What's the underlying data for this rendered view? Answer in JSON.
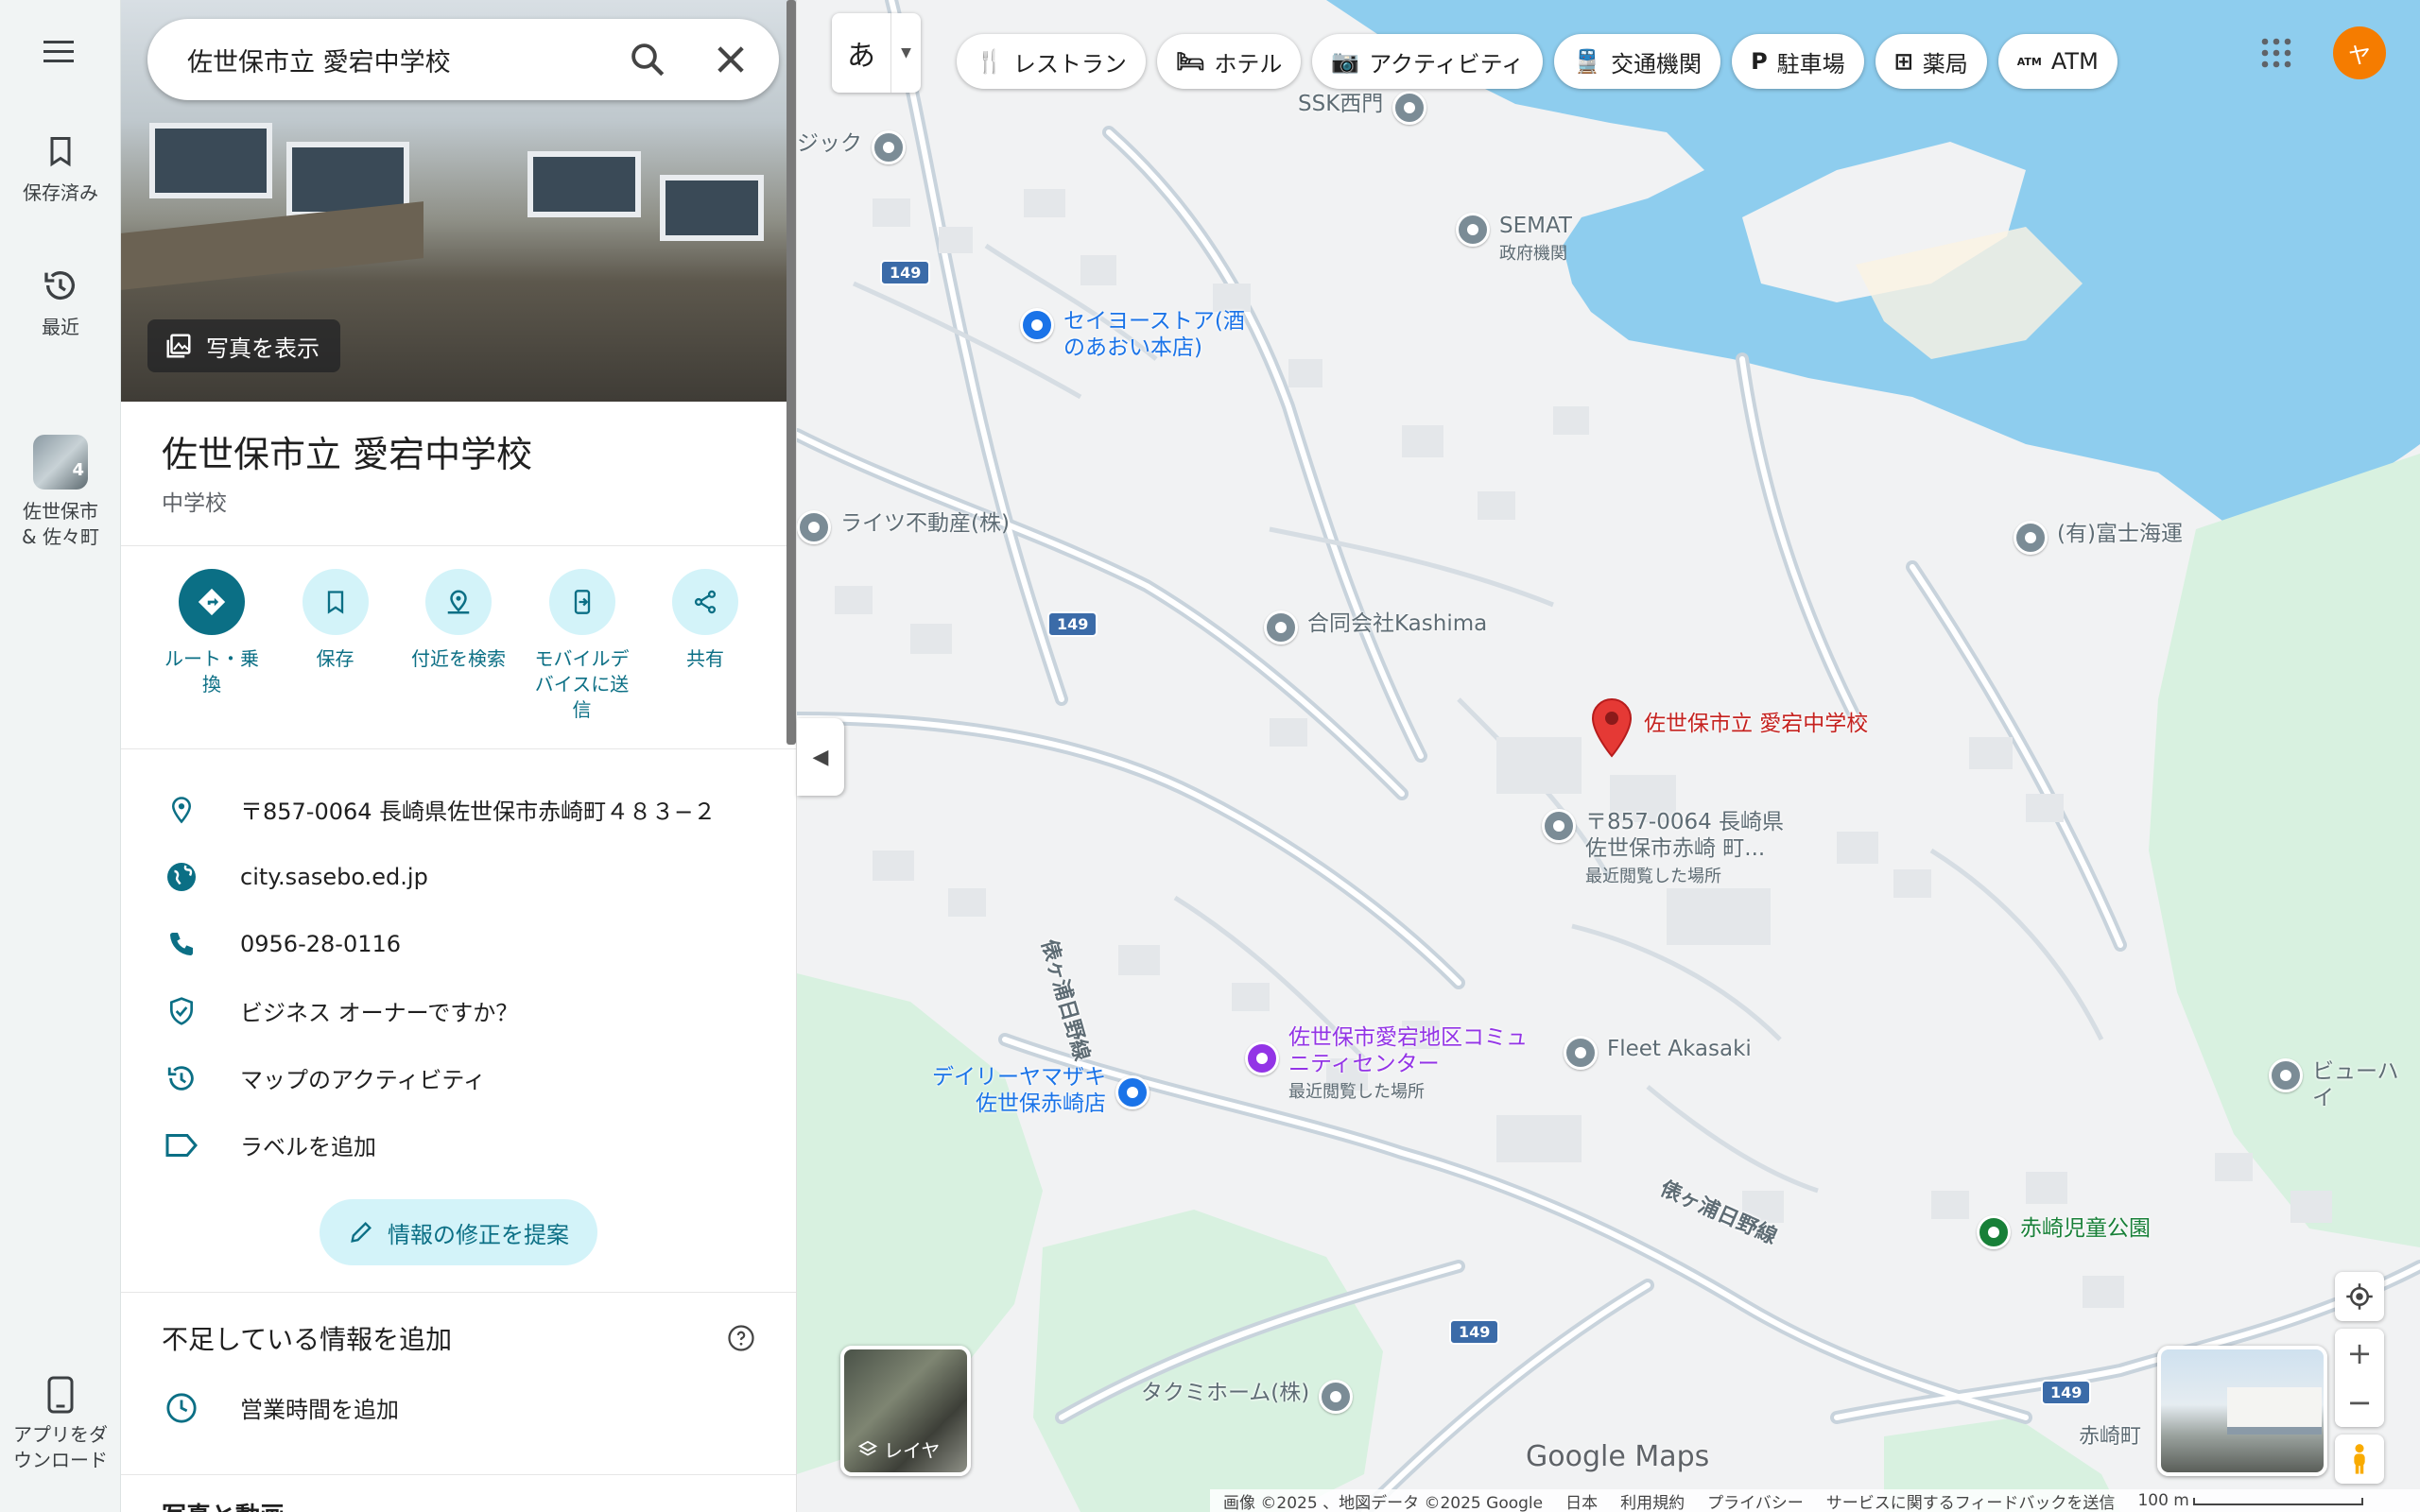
{
  "rail": {
    "saved_label": "保存済み",
    "recent_label": "最近",
    "recent_place_label": "佐世保市 & 佐々町",
    "recent_place_badge": "4",
    "app_download_label": "アプリをダウンロード"
  },
  "search": {
    "value": "佐世保市立 愛宕中学校"
  },
  "panel": {
    "show_photos": "写真を表示",
    "title": "佐世保市立 愛宕中学校",
    "category": "中学校",
    "actions": [
      {
        "label": "ルート・乗換"
      },
      {
        "label": "保存"
      },
      {
        "label": "付近を検索"
      },
      {
        "label": "モバイルデバイスに送信"
      },
      {
        "label": "共有"
      }
    ],
    "info": {
      "address": "〒857-0064 長崎県佐世保市赤崎町４８３−２",
      "website": "city.sasebo.ed.jp",
      "phone": "0956-28-0116",
      "business_owner": "ビジネス オーナーですか？",
      "map_activity": "マップのアクティビティ",
      "add_label": "ラベルを追加"
    },
    "suggest_edit": "情報の修正を提案",
    "missing_info_heading": "不足している情報を追加",
    "add_hours": "営業時間を追加",
    "next_section": "写真と動画"
  },
  "map": {
    "ime_char": "あ",
    "chips": [
      {
        "label": "レストラン",
        "icon": "restaurant-icon"
      },
      {
        "label": "ホテル",
        "icon": "hotel-icon"
      },
      {
        "label": "アクティビティ",
        "icon": "camera-icon"
      },
      {
        "label": "交通機関",
        "icon": "transit-icon"
      },
      {
        "label": "駐車場",
        "icon": "parking-icon"
      },
      {
        "label": "薬局",
        "icon": "pharmacy-icon"
      },
      {
        "label": "ATM",
        "icon": "atm-icon"
      }
    ],
    "account_initial": "ヤ",
    "pois": {
      "ssk": "SSK西門",
      "semat": "SEMAT",
      "semat_sub": "政府機関",
      "jick": "ジック",
      "seiyo": "セイヨーストア(酒のあおい本店)",
      "raitsu": "ライツ不動産(株)",
      "fuji": "(有)富士海運",
      "kashima": "合同会社Kashima",
      "school": "佐世保市立 愛宕中学校",
      "address_pin": "〒857-0064 長崎県佐世保市赤崎 町...",
      "address_sub": "最近閲覧した場所",
      "community": "佐世保市愛宕地区コミュニティセンター",
      "community_sub": "最近閲覧した場所",
      "fleet": "Fleet Akasaki",
      "daily": "デイリーヤマザキ佐世保赤崎店",
      "view": "ビューハイ",
      "park": "赤崎児童公園",
      "takumi": "タクミホーム(株)",
      "akasaki": "赤崎町"
    },
    "road_names": {
      "r1": "俵ヶ浦日野線",
      "r2": "俵ヶ浦日野線"
    },
    "route_shields": [
      "149",
      "149",
      "149",
      "149"
    ],
    "layers_label": "レイヤ",
    "logo": "Google Maps",
    "footer": {
      "imagery": "画像 ©2025 、地図データ ©2025 Google",
      "country": "日本",
      "terms": "利用規約",
      "privacy": "プライバシー",
      "feedback": "サービスに関するフィードバックを送信",
      "scale": "100 m"
    }
  },
  "colors": {
    "accent": "#0b6f85",
    "accent_light": "#d3f3f9",
    "water": "#8ed0f0",
    "park": "#d8f1e0",
    "selected_pin": "#d93025"
  }
}
